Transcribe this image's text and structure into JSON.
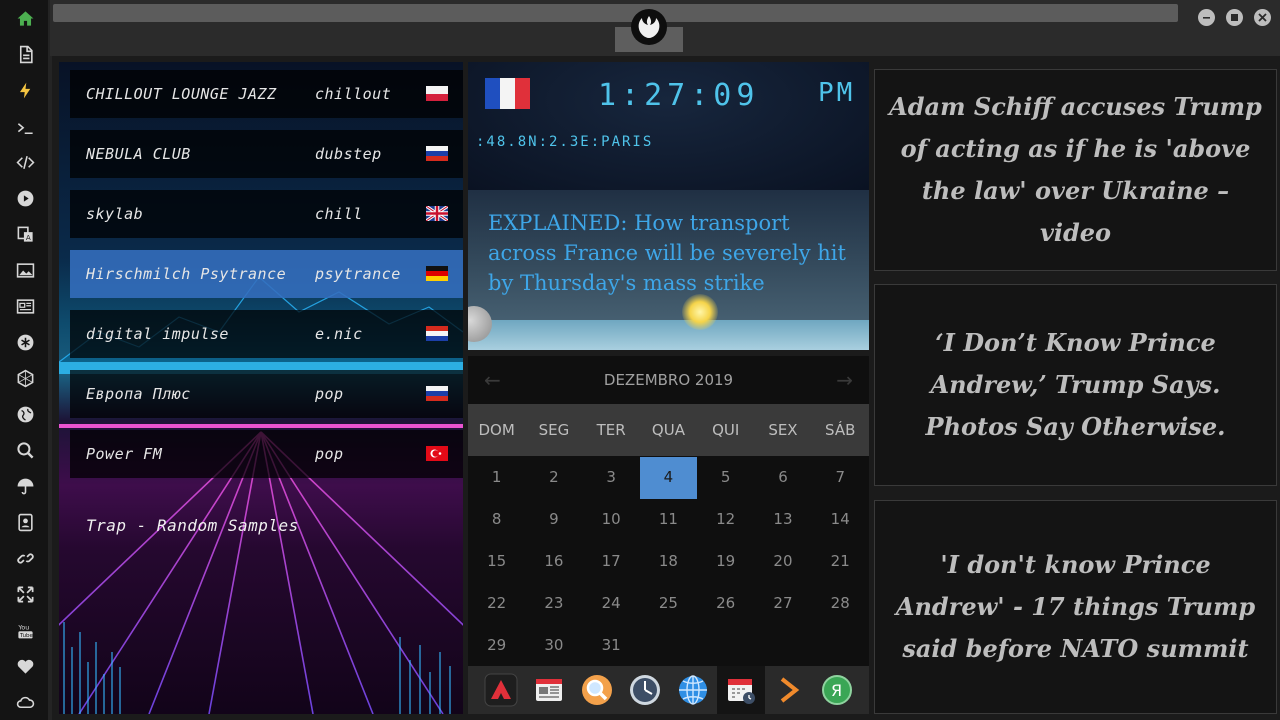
{
  "sidebar": {
    "icons": [
      "home-icon",
      "document-icon",
      "lightning-icon",
      "terminal-icon",
      "code-icon",
      "play-icon",
      "translate-icon",
      "image-icon",
      "news-icon",
      "asterisk-icon",
      "hexagon-icon",
      "globe-icon",
      "search-icon",
      "umbrella-icon",
      "contacts-icon",
      "link-icon",
      "expand-icon",
      "youtube-icon",
      "heart-icon",
      "cloud-icon"
    ]
  },
  "radio": {
    "stations": [
      {
        "name": "CHILLOUT LOUNGE JAZZ",
        "genre": "chillout",
        "flag": "poland"
      },
      {
        "name": "NEBULA CLUB",
        "genre": "dubstep",
        "flag": "russia"
      },
      {
        "name": "skylab",
        "genre": "chill",
        "flag": "uk"
      },
      {
        "name": "Hirschmilch Psytrance",
        "genre": "psytrance",
        "flag": "germany"
      },
      {
        "name": "digital impulse",
        "genre": "e.nic",
        "flag": "croatia"
      },
      {
        "name": "Европа Плюс",
        "genre": "pop",
        "flag": "russia"
      },
      {
        "name": "Power FM",
        "genre": "pop",
        "flag": "turkey"
      }
    ],
    "active_index": 3,
    "now_playing": "Trap - Random Samples"
  },
  "clock": {
    "time": "1:27:09",
    "ampm": "PM",
    "location": ":48.8N:2.3E:PARIS",
    "flag": "france",
    "headline": "EXPLAINED: How transport across France will be severely hit by Thursday's mass strike"
  },
  "calendar": {
    "month": "DEZEMBRO 2019",
    "weekdays": [
      "DOM",
      "SEG",
      "TER",
      "QUA",
      "QUI",
      "SEX",
      "SÁB"
    ],
    "weeks": [
      [
        "1",
        "2",
        "3",
        "4",
        "5",
        "6",
        "7"
      ],
      [
        "8",
        "9",
        "10",
        "11",
        "12",
        "13",
        "14"
      ],
      [
        "15",
        "16",
        "17",
        "18",
        "19",
        "20",
        "21"
      ],
      [
        "22",
        "23",
        "24",
        "25",
        "26",
        "27",
        "28"
      ],
      [
        "29",
        "30",
        "31",
        "",
        "",
        "",
        ""
      ]
    ],
    "today": "4"
  },
  "dock": {
    "icons": [
      "red-triangle-app-icon",
      "news-app-icon",
      "search-app-icon",
      "clock-app-icon",
      "globe-app-icon",
      "calendar-app-icon",
      "play-arrow-app-icon",
      "yandex-app-icon"
    ],
    "selected": "calendar-app-icon"
  },
  "news": [
    "Adam Schiff accuses Trump of acting as if he is 'above the law' over Ukraine – video",
    "‘I Don’t Know Prince Andrew,’ Trump Says. Photos Say Otherwise.",
    "'I don't know Prince Andrew' - 17 things Trump said before NATO summit"
  ],
  "colors": {
    "clock_cyan": "#4fc3ea",
    "headline_blue": "#3ea6e8",
    "today_highlight": "#4f8dd1",
    "active_station": "#346ebe",
    "home_icon": "#4caf50",
    "lightning_icon": "#f5c542"
  }
}
